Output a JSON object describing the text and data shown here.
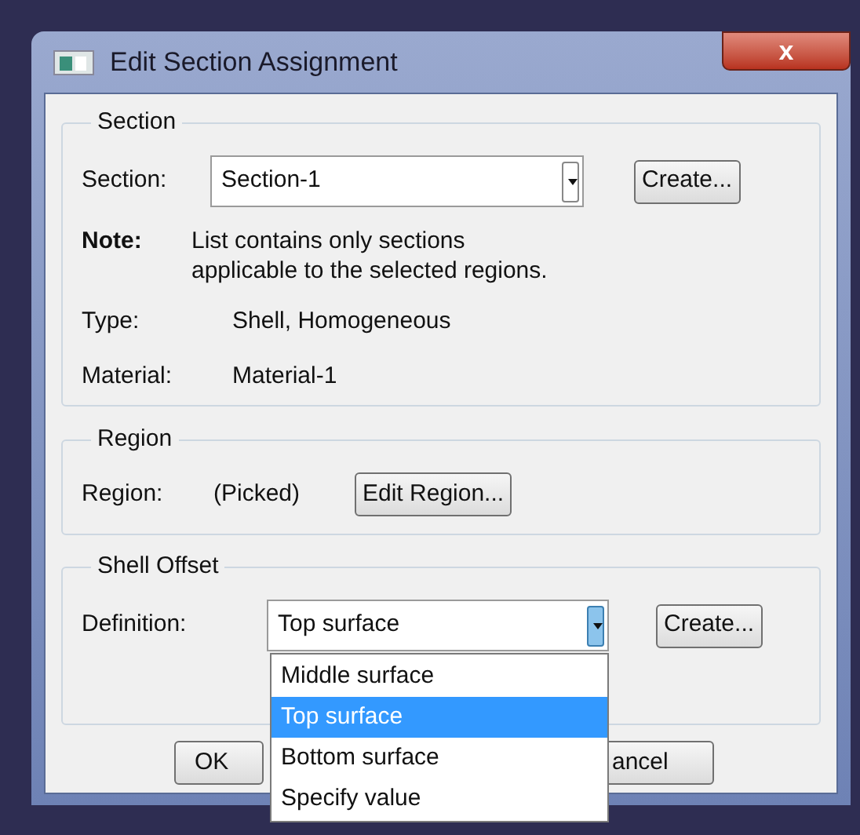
{
  "window": {
    "title": "Edit Section Assignment",
    "close": "x"
  },
  "section": {
    "legend": "Section",
    "label": "Section:",
    "value": "Section-1",
    "create": "Create...",
    "note_label": "Note:",
    "note": "List contains only sections applicable to the selected regions.",
    "type_label": "Type:",
    "type_value": "Shell, Homogeneous",
    "material_label": "Material:",
    "material_value": "Material-1"
  },
  "region": {
    "legend": "Region",
    "label": "Region:",
    "value": "(Picked)",
    "button": "Edit Region..."
  },
  "shell_offset": {
    "legend": "Shell Offset",
    "label": "Definition:",
    "value": "Top surface",
    "create": "Create...",
    "expanded": true,
    "options": [
      {
        "label": "Middle surface",
        "selected": false
      },
      {
        "label": "Top surface",
        "selected": true
      },
      {
        "label": "Bottom surface",
        "selected": false
      },
      {
        "label": "Specify value",
        "selected": false
      }
    ]
  },
  "buttons": [
    "OK",
    "ancel"
  ]
}
